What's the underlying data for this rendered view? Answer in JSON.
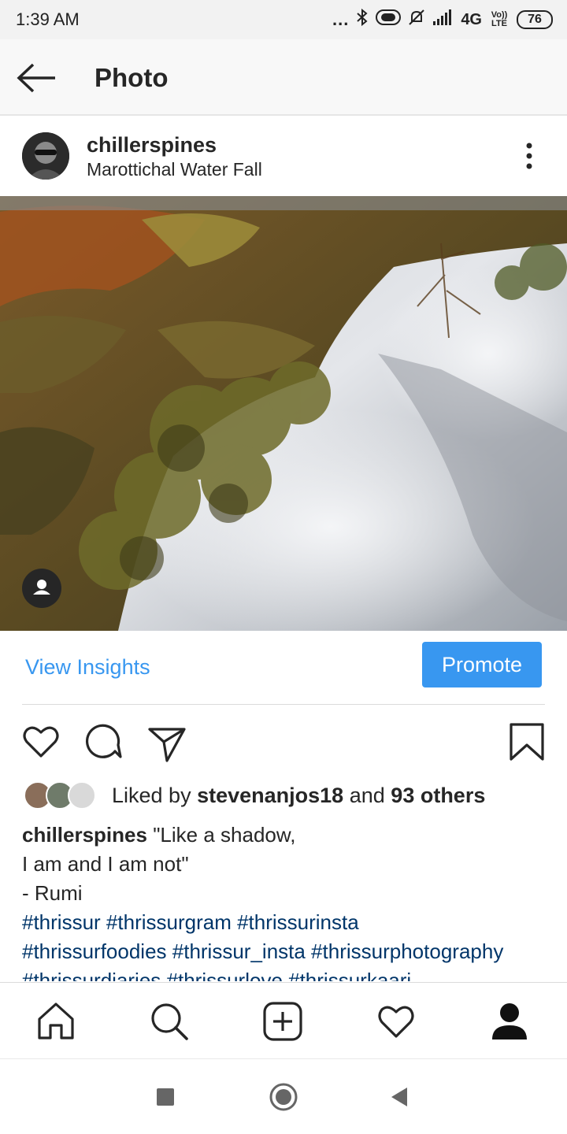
{
  "status_bar": {
    "time": "1:39 AM",
    "dots": "...",
    "network": "4G",
    "volte": "Vo)) LTE",
    "battery": "76"
  },
  "header": {
    "title": "Photo",
    "back_icon": "arrow-left-icon"
  },
  "post": {
    "username": "chillerspines",
    "location": "Marottichal Water Fall",
    "more_icon": "more-vertical-icon"
  },
  "insights": {
    "view_label": "View Insights",
    "promote_label": "Promote"
  },
  "actions": {
    "like_icon": "heart-outline-icon",
    "comment_icon": "comment-icon",
    "share_icon": "paper-plane-icon",
    "save_icon": "bookmark-icon"
  },
  "likes": {
    "prefix": "Liked by",
    "user": "stevenanjos18",
    "middle": "and",
    "others": "93 others"
  },
  "caption": {
    "username": "chillerspines",
    "line1": "\"Like a shadow,",
    "line2": "I am and I am not\"",
    "line3": "- Rumi",
    "tags_line1": "#thrissur #thrissurgram #thrissurinsta",
    "tags_line2": "#thrissurfoodies #thrissur_insta #thrissurphotography",
    "tags_line3": "#thrissurdiaries #thrissurlove #thrissurkaari"
  },
  "bottom_nav": {
    "items": [
      "home-icon",
      "search-icon",
      "add-post-icon",
      "activity-heart-icon",
      "profile-icon"
    ]
  },
  "system_nav": {
    "items": [
      "recents-square-icon",
      "home-circle-icon",
      "back-triangle-icon"
    ]
  },
  "colors": {
    "accent": "#3897f0",
    "hashtag": "#003569",
    "text": "#262626"
  }
}
